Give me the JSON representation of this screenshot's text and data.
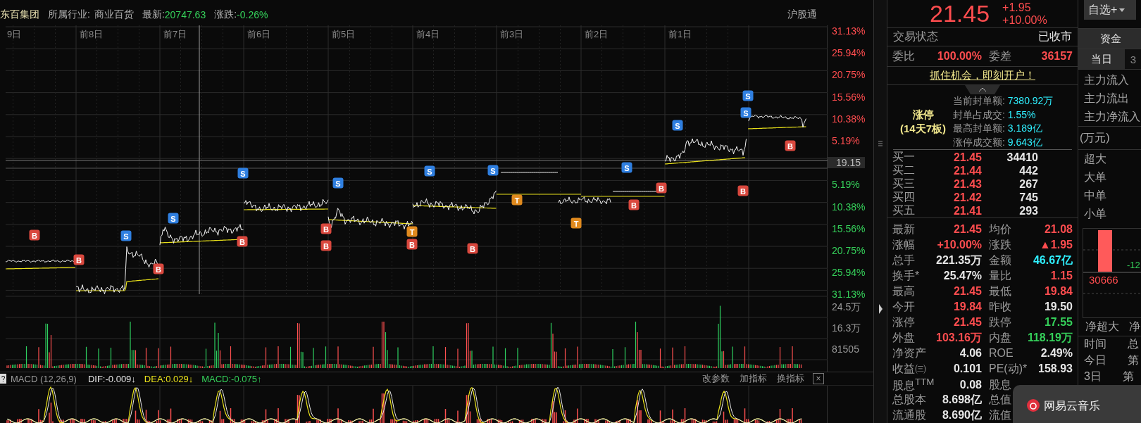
{
  "header": {
    "stock": "东百集团",
    "industry_label": "所属行业:",
    "industry": "商业百货",
    "index_label": "最新:",
    "index_value": "20747.63",
    "change_label": "涨跌:",
    "change_value": "-0.26%",
    "connect": "沪股通"
  },
  "day_labels": [
    "9日",
    "前8日",
    "前7日",
    "前6日",
    "前5日",
    "前4日",
    "前3日",
    "前2日",
    "前1日"
  ],
  "axis_up": [
    "31.13%",
    "25.94%",
    "20.75%",
    "15.56%",
    "10.38%",
    "5.19%"
  ],
  "crosshair_price": "19.15",
  "axis_down": [
    "5.19%",
    "10.38%",
    "15.56%",
    "20.75%",
    "25.94%",
    "31.13%"
  ],
  "volume_axis": [
    "24.5万",
    "16.3万",
    "81505"
  ],
  "markers": [
    {
      "kind": "buy",
      "label": "B"
    },
    {
      "kind": "buy",
      "label": "B"
    },
    {
      "kind": "sell",
      "label": "S"
    },
    {
      "kind": "buy",
      "label": "B"
    },
    {
      "kind": "sell",
      "label": "S"
    },
    {
      "kind": "sell",
      "label": "S"
    },
    {
      "kind": "buy",
      "label": "B"
    },
    {
      "kind": "sell",
      "label": "S"
    },
    {
      "kind": "buy",
      "label": "B"
    },
    {
      "kind": "buy",
      "label": "B"
    },
    {
      "kind": "sell",
      "label": "S"
    },
    {
      "kind": "t",
      "label": "T"
    },
    {
      "kind": "buy",
      "label": "B"
    },
    {
      "kind": "buy",
      "label": "B"
    },
    {
      "kind": "sell",
      "label": "S"
    },
    {
      "kind": "t",
      "label": "T"
    },
    {
      "kind": "t",
      "label": "T"
    },
    {
      "kind": "sell",
      "label": "S"
    },
    {
      "kind": "buy",
      "label": "B"
    },
    {
      "kind": "buy",
      "label": "B"
    },
    {
      "kind": "sell",
      "label": "S"
    },
    {
      "kind": "buy",
      "label": "B"
    },
    {
      "kind": "sell",
      "label": "S"
    },
    {
      "kind": "sell",
      "label": "S"
    },
    {
      "kind": "buy",
      "label": "B"
    }
  ],
  "macd": {
    "help": "?",
    "title": "MACD (12,26,9)",
    "dif": "DIF:-0.009↓",
    "dea": "DEA:0.029↓",
    "value": "MACD:-0.075↑",
    "buttons": [
      "改参数",
      "加指标",
      "换指标"
    ],
    "close": "×"
  },
  "quote": {
    "price": "21.45",
    "change": "+1.95",
    "change_pct": "+10.00%",
    "status": {
      "label": "交易状态",
      "value": "已收市"
    },
    "ratio": {
      "label": "委比",
      "value": "100.00%",
      "diff_label": "委差",
      "diff_value": "36157"
    },
    "link": "抓住机会，即刻开户！",
    "limit": {
      "title": "涨停",
      "subtitle": "(14天7板)",
      "lines": [
        {
          "label": "当前封单额:",
          "value": "7380.92万"
        },
        {
          "label": "封单占成交:",
          "value": "1.55%"
        },
        {
          "label": "最高封单额:",
          "value": "3.189亿"
        },
        {
          "label": "涨停成交额:",
          "value": "9.643亿"
        }
      ]
    },
    "order_book": [
      {
        "label": "买一",
        "price": "21.45",
        "volume": "34410"
      },
      {
        "label": "买二",
        "price": "21.44",
        "volume": "442"
      },
      {
        "label": "买三",
        "price": "21.43",
        "volume": "267"
      },
      {
        "label": "买四",
        "price": "21.42",
        "volume": "745"
      },
      {
        "label": "买五",
        "price": "21.41",
        "volume": "293"
      }
    ],
    "stats": [
      {
        "label": "最新",
        "value": "21.45",
        "color": "#ff4d4f"
      },
      {
        "label": "均价",
        "value": "21.08",
        "color": "#ff4d4f"
      },
      {
        "label": "涨幅",
        "value": "+10.00%",
        "color": "#ff4d4f"
      },
      {
        "label": "涨跌",
        "value": "▲1.95",
        "color": "#ff4d4f"
      },
      {
        "label": "总手",
        "value": "221.35万",
        "color": "#e6e6e6"
      },
      {
        "label": "金额",
        "value": "46.67亿",
        "color": "#2ff0ff"
      },
      {
        "label": "换手*",
        "value": "25.47%",
        "color": "#e6e6e6"
      },
      {
        "label": "量比",
        "value": "1.15",
        "color": "#ff4d4f"
      },
      {
        "label": "最高",
        "value": "21.45",
        "color": "#ff4d4f"
      },
      {
        "label": "最低",
        "value": "19.84",
        "color": "#ff4d4f"
      },
      {
        "label": "今开",
        "value": "19.84",
        "color": "#ff4d4f"
      },
      {
        "label": "昨收",
        "value": "19.50",
        "color": "#e6e6e6"
      },
      {
        "label": "涨停",
        "value": "21.45",
        "color": "#ff4d4f"
      },
      {
        "label": "跌停",
        "value": "17.55",
        "color": "#35d05a"
      },
      {
        "label": "外盘",
        "value": "103.16万",
        "color": "#ff4d4f"
      },
      {
        "label": "内盘",
        "value": "118.19万",
        "color": "#35d05a"
      },
      {
        "label": "净资产",
        "value": "4.06",
        "color": "#e6e6e6"
      },
      {
        "label": "ROE",
        "value": "2.49%",
        "color": "#e6e6e6"
      },
      {
        "label": "收益㈢",
        "value": "0.101",
        "color": "#e6e6e6"
      },
      {
        "label": "PE(动)*",
        "value": "158.93",
        "color": "#e6e6e6"
      },
      {
        "label": "股息$^{TTM}$",
        "value": "0.08",
        "color": "#e6e6e6"
      },
      {
        "label": "股息"
      },
      {
        "label": "总股本",
        "value": "8.698亿",
        "color": "#e6e6e6"
      },
      {
        "label": "总值"
      },
      {
        "label": "流通股",
        "value": "8.690亿",
        "color": "#e6e6e6"
      },
      {
        "label": "流值"
      }
    ]
  },
  "funds": {
    "watch_button": "自选+",
    "tabs": [
      {
        "label": "资金",
        "selected": true
      }
    ],
    "period_tabs": [
      {
        "label": "当日",
        "selected": true
      },
      {
        "label": "3",
        "selected": false
      }
    ],
    "flows": [
      "主力流入",
      "主力流出",
      "主力净流入"
    ],
    "unit": "(万元)",
    "sizes": [
      "超大",
      "大单",
      "中单",
      "小单"
    ],
    "bar_labels": [
      {
        "text": "30666",
        "color": "#ff4d4f"
      },
      {
        "text": "-12",
        "color": "#35d05a"
      }
    ],
    "net_headers": [
      "净超大",
      "净"
    ],
    "rank_rows": [
      {
        "period": "时间",
        "value": "总"
      },
      {
        "period": "今日",
        "value": "第"
      },
      {
        "period": "3日",
        "value": "第"
      }
    ]
  },
  "toast": {
    "app": "网易云音乐"
  }
}
